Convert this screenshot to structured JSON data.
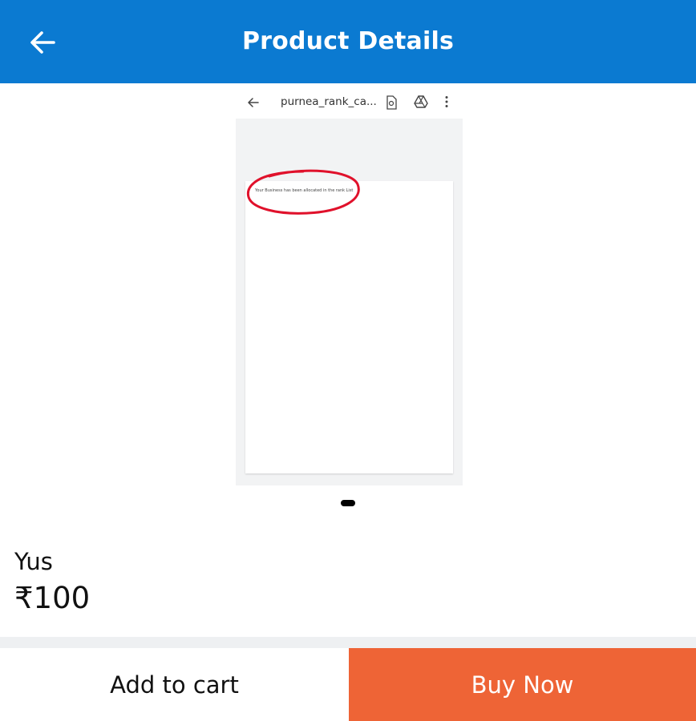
{
  "header": {
    "title": "Product Details",
    "back_icon": "arrow-left-icon",
    "background": "#0b7ad1"
  },
  "carousel": {
    "image": {
      "toolbar_title": "purnea_rank_ca...",
      "page_text": "Your Business has been allocated in the rank List",
      "annotation_color": "#e0112b"
    },
    "page_count": 1,
    "active_index": 0
  },
  "product": {
    "name": "Yus",
    "price": "₹100"
  },
  "actions": {
    "add_to_cart": "Add to cart",
    "buy_now": "Buy Now",
    "buy_color": "#ee6436"
  }
}
